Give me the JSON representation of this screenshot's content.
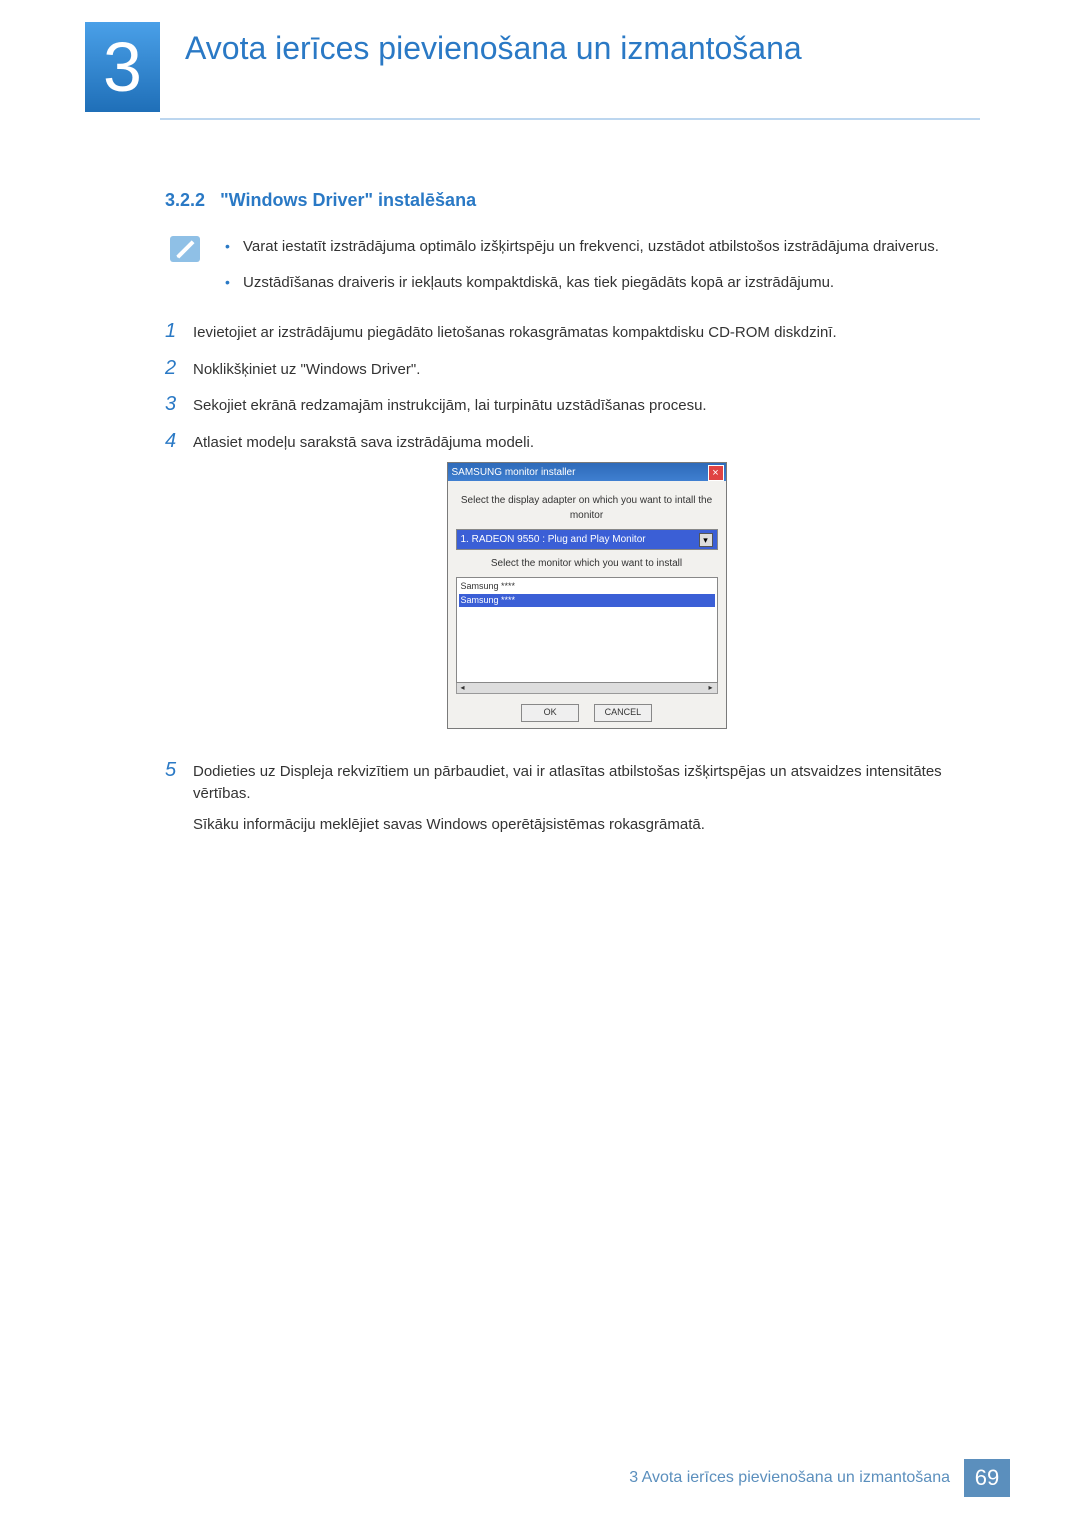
{
  "chapter": {
    "number": "3",
    "title": "Avota ierīces pievienošana un izmantošana"
  },
  "section": {
    "number": "3.2.2",
    "title": "\"Windows Driver\" instalēšana"
  },
  "note_bullets": [
    "Varat iestatīt izstrādājuma optimālo izšķirtspēju un frekvenci, uzstādot atbilstošos izstrādājuma draiverus.",
    "Uzstādīšanas draiveris ir iekļauts kompaktdiskā, kas tiek piegādāts kopā ar izstrādājumu."
  ],
  "steps": [
    "Ievietojiet ar izstrādājumu piegādāto lietošanas rokasgrāmatas kompaktdisku CD-ROM diskdzinī.",
    "Noklikšķiniet uz \"Windows Driver\".",
    "Sekojiet ekrānā redzamajām instrukcijām, lai turpinātu uzstādīšanas procesu.",
    "Atlasiet modeļu sarakstā sava izstrādājuma modeli."
  ],
  "step5": {
    "text1": "Dodieties uz Displeja rekvizītiem un pārbaudiet, vai ir atlasītas atbilstošas izšķirtspējas un atsvaidzes intensitātes vērtības.",
    "text2": "Sīkāku informāciju meklējiet savas Windows operētājsistēmas rokasgrāmatā."
  },
  "dialog": {
    "title": "SAMSUNG monitor installer",
    "label1": "Select the display adapter on which you want to intall the monitor",
    "select_value": "1. RADEON 9550 : Plug and Play Monitor",
    "label2": "Select the monitor which you want to install",
    "list": {
      "item0": "Samsung ****",
      "item1_selected": "Samsung ****"
    },
    "ok": "OK",
    "cancel": "CANCEL"
  },
  "footer": {
    "text": "3 Avota ierīces pievienošana un izmantošana",
    "page": "69"
  }
}
